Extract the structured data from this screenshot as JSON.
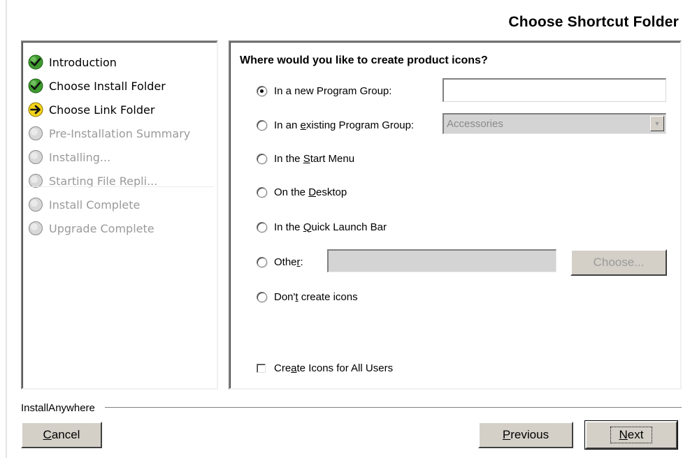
{
  "header": {
    "title": "Choose Shortcut Folder"
  },
  "steps": [
    {
      "label": "Introduction",
      "state": "done",
      "icon": "check-icon"
    },
    {
      "label": "Choose Install Folder",
      "state": "done",
      "icon": "check-icon"
    },
    {
      "label": "Choose Link Folder",
      "state": "current",
      "icon": "arrow-right-icon"
    },
    {
      "label": "Pre-Installation Summary",
      "state": "todo",
      "icon": "circle-icon"
    },
    {
      "label": "Installing...",
      "state": "todo",
      "icon": "circle-icon"
    },
    {
      "label": "Starting File Repli...",
      "state": "todo",
      "icon": "circle-icon"
    },
    {
      "label": "Install Complete",
      "state": "todo",
      "icon": "circle-icon"
    },
    {
      "label": "Upgrade Complete",
      "state": "todo",
      "icon": "circle-icon"
    }
  ],
  "main": {
    "question": "Where would you like to create product icons?",
    "options": {
      "new_group": {
        "pre": "In a new Pro",
        "u": "g",
        "post": "ram Group:"
      },
      "existing_group": {
        "pre": "In an ",
        "u": "e",
        "post": "xisting Program Group:"
      },
      "start_menu": {
        "pre": "In the ",
        "u": "S",
        "post": "tart Menu"
      },
      "desktop": {
        "pre": "On the ",
        "u": "D",
        "post": "esktop"
      },
      "quick_launch": {
        "pre": "In the ",
        "u": "Q",
        "post": "uick Launch Bar"
      },
      "other": {
        "pre": "Othe",
        "u": "r",
        "post": ":"
      },
      "none": {
        "pre": "Don'",
        "u": "t",
        "post": " create icons"
      }
    },
    "selected_option": "new_group",
    "new_group_value": "",
    "existing_group_selected": "Accessories",
    "other_value": "",
    "choose_label": "Choose...",
    "all_users": {
      "pre": "Cre",
      "u": "a",
      "post": "te Icons for All Users",
      "checked": false
    }
  },
  "footer": {
    "brand": "InstallAnywhere",
    "cancel": {
      "u": "C",
      "post": "ancel"
    },
    "previous": {
      "u": "P",
      "post": "revious"
    },
    "next": {
      "u": "N",
      "post": "ext"
    }
  },
  "colors": {
    "check_green": "#3f9b2f",
    "arrow_yellow": "#f2d21a",
    "button_face": "#d4d0c8"
  }
}
